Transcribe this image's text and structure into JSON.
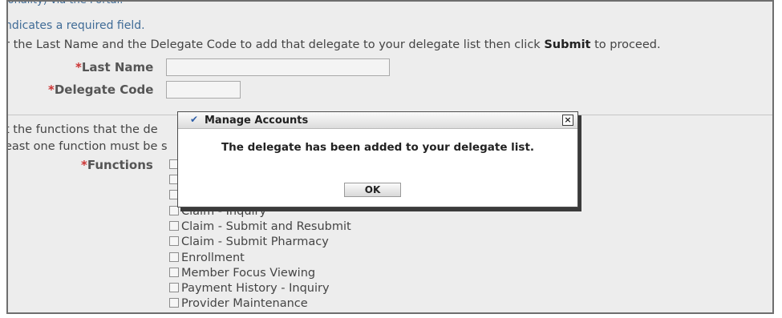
{
  "header": {
    "clipped_line": "ionality) via the Portal.",
    "required_note": "ndicates a required field.",
    "instruction_pre": "r the Last Name and the Delegate Code to add that delegate to your delegate list then click ",
    "instruction_bold": "Submit",
    "instruction_post": " to proceed."
  },
  "form": {
    "required_mark": "*",
    "last_name_label": "Last Name",
    "last_name_value": "",
    "delegate_code_label": "Delegate Code",
    "delegate_code_value": ""
  },
  "functions": {
    "intro_line1": "t the functions that the de",
    "intro_line2": "east one function must be s",
    "label": "Functions",
    "items": [
      "",
      "",
      "",
      "Claim - Inquiry",
      "Claim - Submit and Resubmit",
      "Claim - Submit Pharmacy",
      "Enrollment",
      "Member Focus Viewing",
      "Payment History - Inquiry",
      "Provider Maintenance"
    ]
  },
  "dialog": {
    "check_icon": "checkmark-icon",
    "title": "Manage Accounts",
    "close_glyph": "×",
    "message": "The delegate has been added to your delegate list.",
    "ok_label": "OK"
  }
}
